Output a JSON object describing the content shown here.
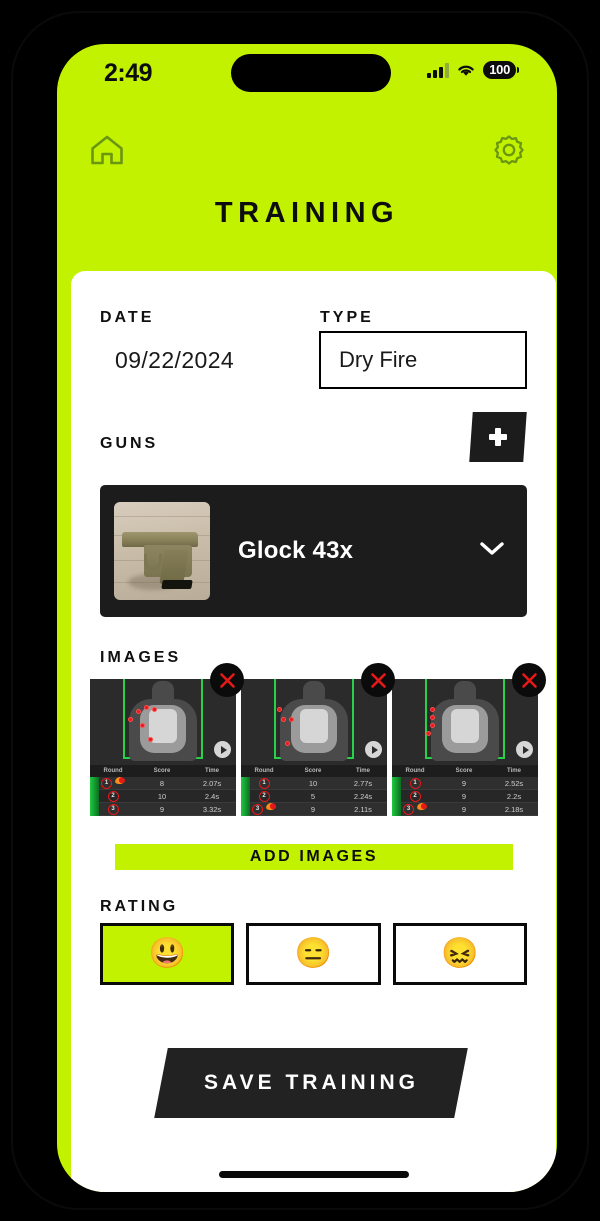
{
  "theme": {
    "accent": "#c3f200",
    "dark": "#1c1c1c",
    "card": "#ffffff"
  },
  "status_bar": {
    "time": "2:49",
    "battery": "100",
    "signal_icon": "cellular-signal-icon",
    "wifi_icon": "wifi-icon",
    "battery_icon": "battery-icon"
  },
  "nav": {
    "home_icon": "home-icon",
    "settings_icon": "gear-icon",
    "title": "TRAINING"
  },
  "form": {
    "date_label": "DATE",
    "date_value": "09/22/2024",
    "type_label": "TYPE",
    "type_value": "Dry Fire",
    "type_options": [
      "Dry Fire"
    ]
  },
  "guns": {
    "label": "GUNS",
    "add_icon": "plus-icon",
    "selected": {
      "name": "Glock 43x",
      "photo_alt": "gun-photo",
      "chevron_icon": "chevron-down-icon"
    }
  },
  "images": {
    "label": "IMAGES",
    "add_button_label": "ADD IMAGES",
    "delete_icon": "close-icon",
    "play_icon": "play-icon",
    "columns": [
      "Round",
      "Score",
      "Time"
    ],
    "items": [
      {
        "rows": [
          {
            "round": "1",
            "score": "8",
            "time": "2.07s",
            "flame": true
          },
          {
            "round": "2",
            "score": "10",
            "time": "2.4s",
            "flame": false
          },
          {
            "round": "3",
            "score": "9",
            "time": "3.32s",
            "flame": false
          }
        ],
        "hits": [
          [
            46,
            30
          ],
          [
            54,
            26
          ],
          [
            62,
            28
          ],
          [
            38,
            38
          ],
          [
            50,
            44
          ],
          [
            58,
            58
          ]
        ]
      },
      {
        "rows": [
          {
            "round": "1",
            "score": "10",
            "time": "2.77s",
            "flame": false
          },
          {
            "round": "2",
            "score": "5",
            "time": "2.24s",
            "flame": false
          },
          {
            "round": "3",
            "score": "9",
            "time": "2.11s",
            "flame": true
          }
        ],
        "hits": [
          [
            36,
            28
          ],
          [
            40,
            38
          ],
          [
            48,
            38
          ],
          [
            44,
            62
          ]
        ]
      },
      {
        "rows": [
          {
            "round": "1",
            "score": "9",
            "time": "2.52s",
            "flame": false
          },
          {
            "round": "2",
            "score": "9",
            "time": "2.2s",
            "flame": false
          },
          {
            "round": "3",
            "score": "9",
            "time": "2.18s",
            "flame": true
          }
        ],
        "hits": [
          [
            38,
            28
          ],
          [
            38,
            36
          ],
          [
            38,
            44
          ],
          [
            34,
            52
          ]
        ]
      }
    ]
  },
  "rating": {
    "label": "RATING",
    "options": [
      {
        "emoji": "😃",
        "name": "rating-good",
        "selected": true
      },
      {
        "emoji": "😑",
        "name": "rating-neutral",
        "selected": false
      },
      {
        "emoji": "😖",
        "name": "rating-bad",
        "selected": false
      }
    ]
  },
  "save": {
    "label": "SAVE TRAINING"
  }
}
